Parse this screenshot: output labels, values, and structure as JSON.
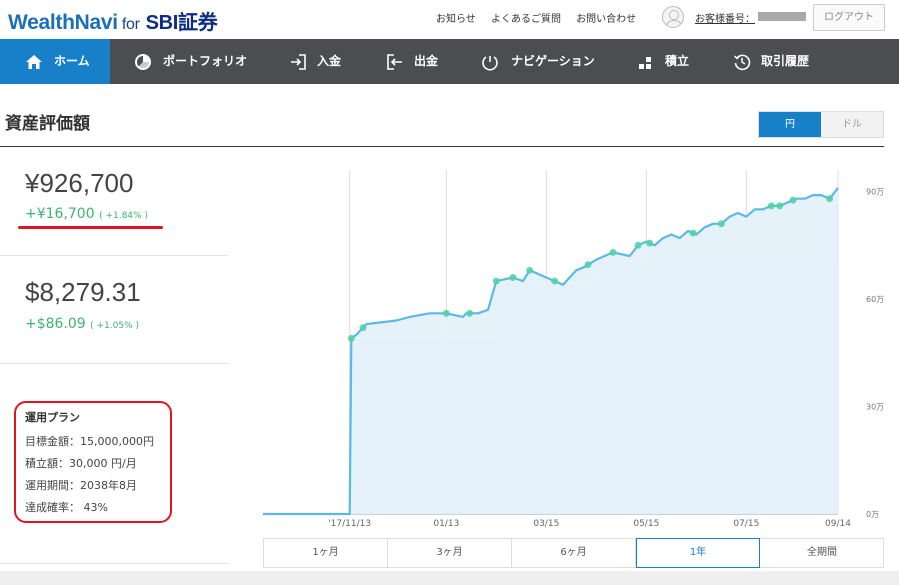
{
  "header": {
    "logo_main": "WealthNavi",
    "logo_for": "for",
    "logo_partner": "SBI証券",
    "links": [
      "お知らせ",
      "よくあるご質問",
      "お問い合わせ"
    ],
    "customer_no_label": "お客様番号：",
    "logout_label": "ログアウト"
  },
  "nav": {
    "items": [
      {
        "label": "ホーム",
        "icon": "home-icon",
        "active": true
      },
      {
        "label": "ポートフォリオ",
        "icon": "pie-chart-icon",
        "active": false
      },
      {
        "label": "入金",
        "icon": "deposit-icon",
        "active": false
      },
      {
        "label": "出金",
        "icon": "withdraw-icon",
        "active": false
      },
      {
        "label": "ナビゲーション",
        "icon": "gauge-icon",
        "active": false
      },
      {
        "label": "積立",
        "icon": "bar-blocks-icon",
        "active": false
      },
      {
        "label": "取引履歴",
        "icon": "history-icon",
        "active": false
      }
    ]
  },
  "page": {
    "title": "資産評価額",
    "currency_toggle": {
      "yen": "円",
      "usd": "ドル",
      "selected": "円"
    }
  },
  "balance": {
    "jpy": {
      "value": "¥926,700",
      "delta": "+¥16,700",
      "pct": "( +1.84% )"
    },
    "usd": {
      "value": "$8,279.31",
      "delta": "+$86.09",
      "pct": "( +1.05% )"
    }
  },
  "plan": {
    "title": "運用プラン",
    "rows": [
      "目標金額：15,000,000円",
      "積立額：30,000 円/月",
      "運用期間：2038年8月",
      "達成確率： 43%"
    ]
  },
  "colors": {
    "brand_blue": "#1780c8",
    "nav_bg": "#4b4d51",
    "gain_green": "#3cb371",
    "highlight_red": "#e0141e",
    "line_blue": "#5cb8e6",
    "area_fill": "#e3f1fa",
    "marker_green": "#4fd1a5"
  },
  "chart_data": {
    "type": "area",
    "x_tick_labels": [
      "'17/11/13",
      "01/13",
      "03/15",
      "05/15",
      "07/15",
      "09/14"
    ],
    "y_tick_labels": [
      "0万",
      "30万",
      "60万",
      "90万"
    ],
    "ylim": [
      0,
      96
    ],
    "xlim_days": [
      0,
      345
    ],
    "x_days": [
      0,
      52,
      53,
      56,
      62,
      80,
      88,
      100,
      110,
      120,
      122,
      129,
      135,
      140,
      150,
      156,
      160,
      170,
      180,
      188,
      193,
      200,
      205,
      210,
      220,
      225,
      230,
      235,
      240,
      245,
      250,
      255,
      260,
      265,
      270,
      275,
      280,
      285,
      290,
      295,
      300,
      305,
      310,
      315,
      320,
      325,
      330,
      335,
      340,
      345
    ],
    "values": [
      0,
      0,
      49,
      50,
      53,
      54,
      55,
      56,
      56,
      55,
      56,
      56,
      57,
      65,
      66,
      65,
      68,
      66,
      64,
      68,
      69,
      71,
      72,
      73,
      72,
      75,
      76,
      75,
      77,
      78,
      77,
      79,
      78,
      80,
      81,
      81,
      83,
      84,
      83,
      85,
      85,
      86,
      86,
      87,
      88,
      88,
      89,
      89,
      88,
      91
    ],
    "contribution_steps": [
      {
        "x": 53,
        "value": 49
      },
      {
        "x": 140,
        "value": 64
      },
      {
        "x": 200,
        "value": 70
      },
      {
        "x": 345,
        "value": 91
      }
    ],
    "marker_days": [
      53,
      60,
      110,
      124,
      140,
      150,
      160,
      175,
      195,
      210,
      225,
      232,
      258,
      275,
      305,
      310,
      318,
      340
    ]
  },
  "periods": {
    "tabs": [
      "1ヶ月",
      "3ヶ月",
      "6ヶ月",
      "1年",
      "全期間"
    ],
    "selected": "1年"
  }
}
